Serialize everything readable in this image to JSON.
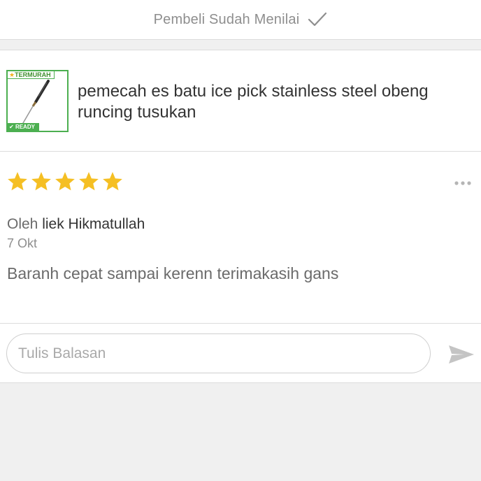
{
  "status": {
    "text": "Pembeli Sudah Menilai",
    "icon": "check-icon"
  },
  "product": {
    "name": "pemecah es batu ice pick stainless steel obeng runcing tusukan",
    "thumbnail": {
      "badge_top": "TERMURAH",
      "badge_bottom": "READY",
      "icon": "ice-pick-image"
    }
  },
  "review": {
    "rating": 5,
    "rating_max": 5,
    "star_color": "#f5bf23",
    "by_label": "Oleh",
    "author": "liek Hikmatullah",
    "date": "7 Okt",
    "text": "Baranh cepat sampai kerenn terimakasih gans",
    "more_icon": "more-dots-icon"
  },
  "reply": {
    "placeholder": "Tulis Balasan",
    "value": "",
    "send_icon": "send-icon"
  },
  "colors": {
    "accent_green": "#4caf50",
    "text_primary": "#333333",
    "text_muted": "#8e8e8e",
    "background": "#f0f0f0"
  }
}
